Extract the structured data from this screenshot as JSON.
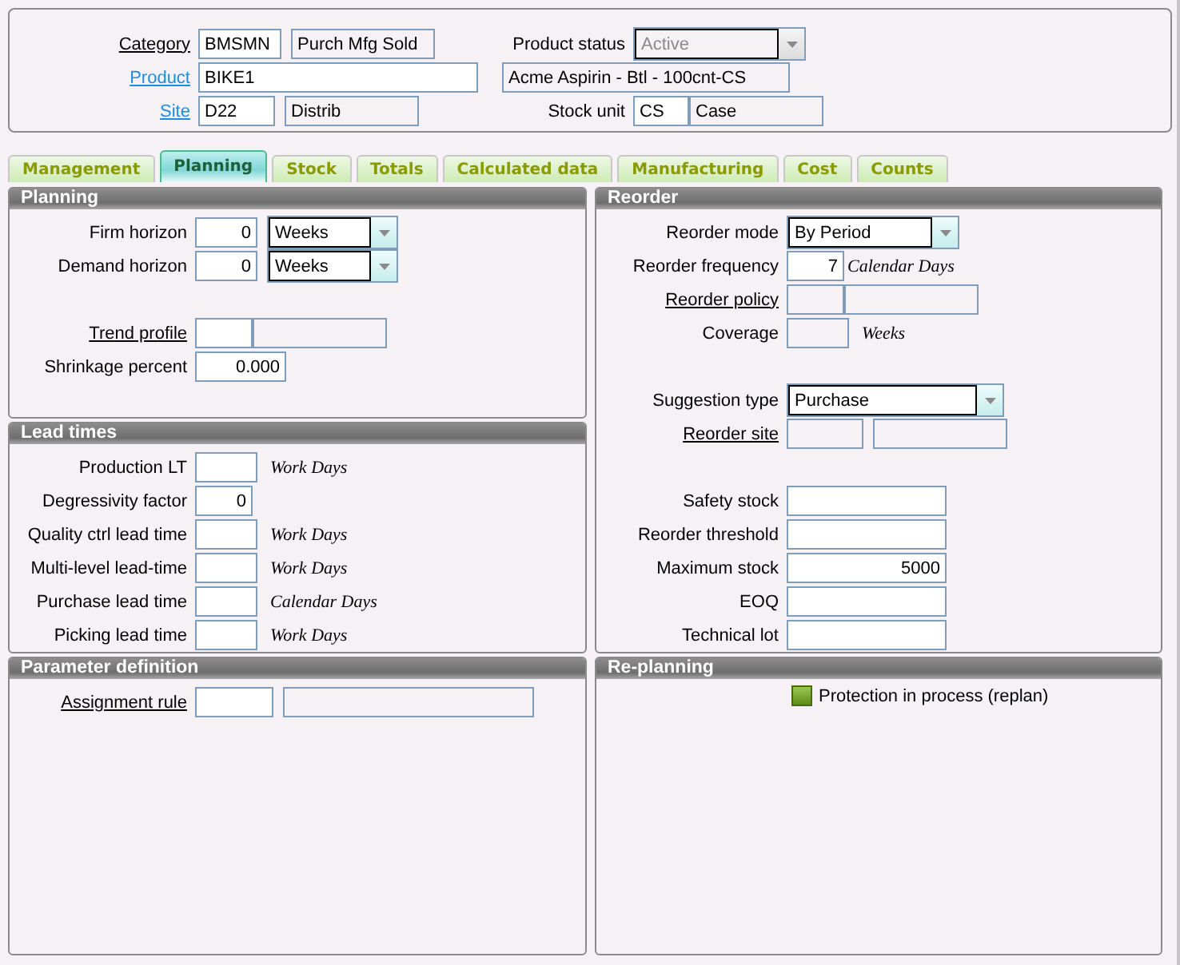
{
  "header": {
    "left": [
      {
        "label": "Category",
        "underlined": true,
        "linked": false,
        "boxes": [
          {
            "value": "BMSMN",
            "kind": "entry"
          },
          {
            "value": "Purch Mfg Sold",
            "kind": "display"
          }
        ]
      },
      {
        "label": "Product",
        "underlined": true,
        "linked": true,
        "boxes": [
          {
            "value": "BIKE1",
            "kind": "entry"
          }
        ]
      },
      {
        "label": "Site",
        "underlined": true,
        "linked": true,
        "boxes": [
          {
            "value": "D22",
            "kind": "entry"
          },
          {
            "value": "Distrib",
            "kind": "display"
          }
        ]
      }
    ],
    "right": [
      {
        "label": "Product status",
        "underlined": false,
        "linked": false,
        "boxes": [
          {
            "value": "Active",
            "kind": "select",
            "disabled": true
          }
        ]
      },
      {
        "boxes": [
          {
            "value": "Acme Aspirin - Btl - 100cnt-CS",
            "kind": "display"
          }
        ]
      },
      {
        "label": "Stock unit",
        "underlined": false,
        "linked": false,
        "boxes": [
          {
            "value": "CS",
            "kind": "entry"
          },
          {
            "value": "Case",
            "kind": "display"
          }
        ]
      }
    ]
  },
  "tabs": [
    {
      "label": "Management",
      "selected": false
    },
    {
      "label": "Planning",
      "selected": true
    },
    {
      "label": "Stock",
      "selected": false
    },
    {
      "label": "Totals",
      "selected": false
    },
    {
      "label": "Calculated data",
      "selected": false
    },
    {
      "label": "Manufacturing",
      "selected": false
    },
    {
      "label": "Cost",
      "selected": false
    },
    {
      "label": "Counts",
      "selected": false
    }
  ],
  "planning": {
    "title": "Planning",
    "groups": [
      [
        {
          "label": "Firm horizon",
          "underlined": false,
          "linked": false,
          "boxes": [
            {
              "value": "0",
              "kind": "number"
            },
            {
              "value": "Weeks",
              "kind": "select",
              "disabled": false
            }
          ]
        },
        {
          "label": "Demand horizon",
          "underlined": false,
          "linked": false,
          "boxes": [
            {
              "value": "0",
              "kind": "number"
            },
            {
              "value": "Weeks",
              "kind": "select",
              "disabled": false
            }
          ]
        }
      ],
      [
        {
          "label": "Trend profile",
          "underlined": true,
          "linked": false,
          "boxes": [
            {
              "kind": "entry"
            },
            {
              "kind": "display"
            }
          ]
        },
        {
          "label": "Shrinkage percent",
          "underlined": false,
          "linked": false,
          "boxes": [
            {
              "value": "0.000",
              "kind": "number"
            }
          ]
        }
      ]
    ]
  },
  "lead_times": {
    "title": "Lead times",
    "groups": [
      [
        {
          "label": "Production LT",
          "underlined": false,
          "linked": false,
          "boxes": [
            {
              "kind": "entry"
            }
          ],
          "unit": "Work Days"
        },
        {
          "label": "Degressivity factor",
          "underlined": false,
          "linked": false,
          "boxes": [
            {
              "value": "0",
              "kind": "number"
            }
          ]
        },
        {
          "label": "Quality ctrl lead time",
          "underlined": false,
          "linked": false,
          "boxes": [
            {
              "kind": "entry"
            }
          ],
          "unit": "Work Days"
        },
        {
          "label": "Multi-level lead-time",
          "underlined": false,
          "linked": false,
          "boxes": [
            {
              "kind": "entry"
            }
          ],
          "unit": "Work Days"
        },
        {
          "label": "Purchase lead time",
          "underlined": false,
          "linked": false,
          "boxes": [
            {
              "kind": "entry"
            }
          ],
          "unit": "Calendar Days"
        },
        {
          "label": "Picking lead time",
          "underlined": false,
          "linked": false,
          "boxes": [
            {
              "kind": "entry"
            }
          ],
          "unit": "Work Days"
        }
      ]
    ]
  },
  "parameter_definition": {
    "title": "Parameter definition",
    "groups": [
      [
        {
          "label": "Assignment rule",
          "underlined": true,
          "linked": false,
          "boxes": [
            {
              "kind": "entry"
            },
            {
              "kind": "display"
            }
          ]
        }
      ]
    ]
  },
  "reorder": {
    "title": "Reorder",
    "groups": [
      [
        {
          "label": "Reorder mode",
          "underlined": false,
          "linked": false,
          "boxes": [
            {
              "value": "By Period",
              "kind": "select",
              "disabled": false
            }
          ]
        },
        {
          "label": "Reorder frequency",
          "underlined": false,
          "linked": false,
          "boxes": [
            {
              "value": "7",
              "kind": "number"
            }
          ],
          "unit": "Calendar Days"
        },
        {
          "label": "Reorder policy",
          "underlined": true,
          "linked": false,
          "boxes": [
            {
              "kind": "display"
            },
            {
              "kind": "display"
            }
          ]
        },
        {
          "label": "Coverage",
          "underlined": false,
          "linked": false,
          "boxes": [
            {
              "kind": "display"
            }
          ],
          "unit": "Weeks"
        }
      ],
      [
        {
          "label": "Suggestion type",
          "underlined": false,
          "linked": false,
          "boxes": [
            {
              "value": "Purchase",
              "kind": "select",
              "disabled": false
            }
          ]
        },
        {
          "label": "Reorder site",
          "underlined": true,
          "linked": false,
          "boxes": [
            {
              "kind": "display"
            },
            {
              "kind": "display"
            }
          ]
        }
      ],
      [
        {
          "label": "Safety stock",
          "underlined": false,
          "linked": false,
          "boxes": [
            {
              "kind": "entry"
            }
          ]
        },
        {
          "label": "Reorder threshold",
          "underlined": false,
          "linked": false,
          "boxes": [
            {
              "kind": "entry"
            }
          ]
        },
        {
          "label": "Maximum stock",
          "underlined": false,
          "linked": false,
          "boxes": [
            {
              "value": "5000",
              "kind": "number"
            }
          ]
        },
        {
          "label": "EOQ",
          "underlined": false,
          "linked": false,
          "boxes": [
            {
              "kind": "entry"
            }
          ]
        },
        {
          "label": "Technical lot",
          "underlined": false,
          "linked": false,
          "boxes": [
            {
              "kind": "entry"
            }
          ]
        }
      ]
    ]
  },
  "re_planning": {
    "title": "Re-planning",
    "checkbox": {
      "label": "Protection in process (replan)",
      "checked": true
    }
  }
}
